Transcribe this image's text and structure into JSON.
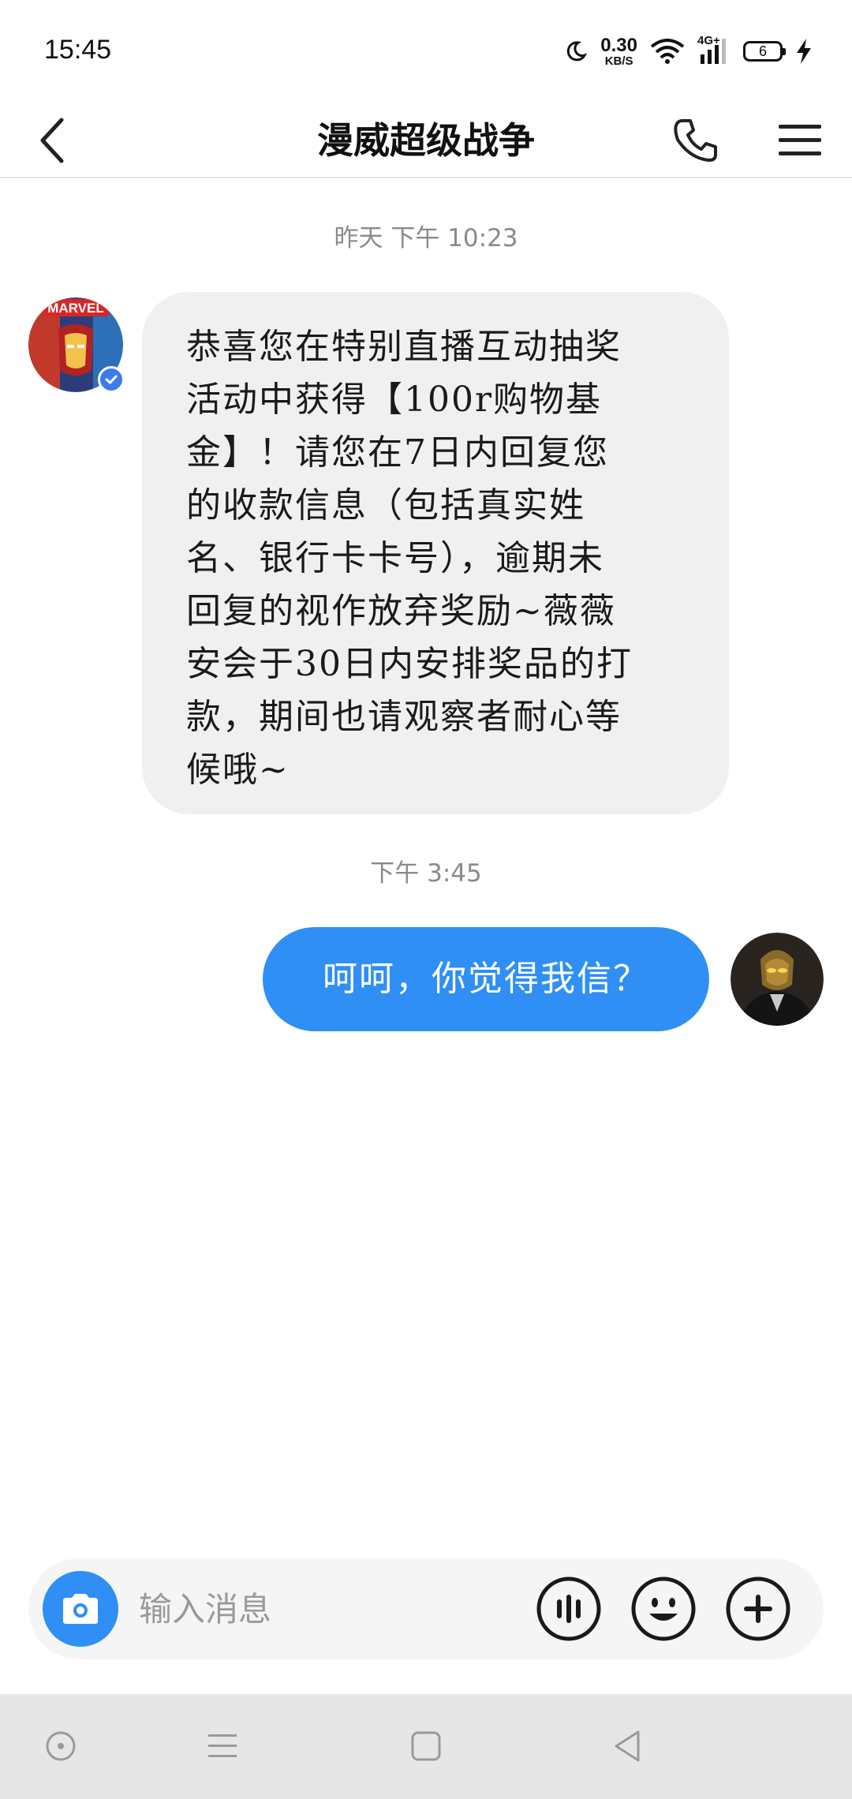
{
  "status_bar": {
    "time": "15:45",
    "net_speed_value": "0.30",
    "net_speed_unit": "KB/S",
    "network": "4G+",
    "battery_level": "6",
    "icons": [
      "moon-icon",
      "wifi-icon",
      "signal-icon",
      "battery-icon",
      "charging-icon"
    ]
  },
  "header": {
    "title": "漫威超级战争",
    "icons": [
      "back-arrow-icon",
      "phone-icon",
      "hamburger-menu-icon"
    ]
  },
  "messages": [
    {
      "time": "昨天 下午 10:23",
      "direction": "incoming",
      "sender_verified": true,
      "lines": [
        "恭喜您在特别直播互动抽奖",
        "活动中获得【100r购物基",
        "金】！请您在7日内回复您",
        "的收款信息（包括真实姓",
        "名、银行卡卡号），逾期未",
        "回复的视作放弃奖励~薇薇",
        "安会于30日内安排奖品的打",
        "款，期间也请观察者耐心等",
        "候哦~"
      ]
    },
    {
      "time": "下午 3:45",
      "direction": "outgoing",
      "text": "呵呵，你觉得我信？"
    }
  ],
  "input_bar": {
    "placeholder": "输入消息",
    "icons": [
      "camera-icon",
      "voice-icon",
      "emoji-icon",
      "plus-icon"
    ]
  },
  "nav_bar": {
    "icons": [
      "assistant-icon",
      "recent-apps-icon",
      "home-icon",
      "back-icon"
    ]
  },
  "colors": {
    "accent": "#2f8ff5",
    "incoming_bubble": "#f0f0f0",
    "verified_badge": "#3d7af0",
    "timestamp_text": "#8a8a8a"
  }
}
